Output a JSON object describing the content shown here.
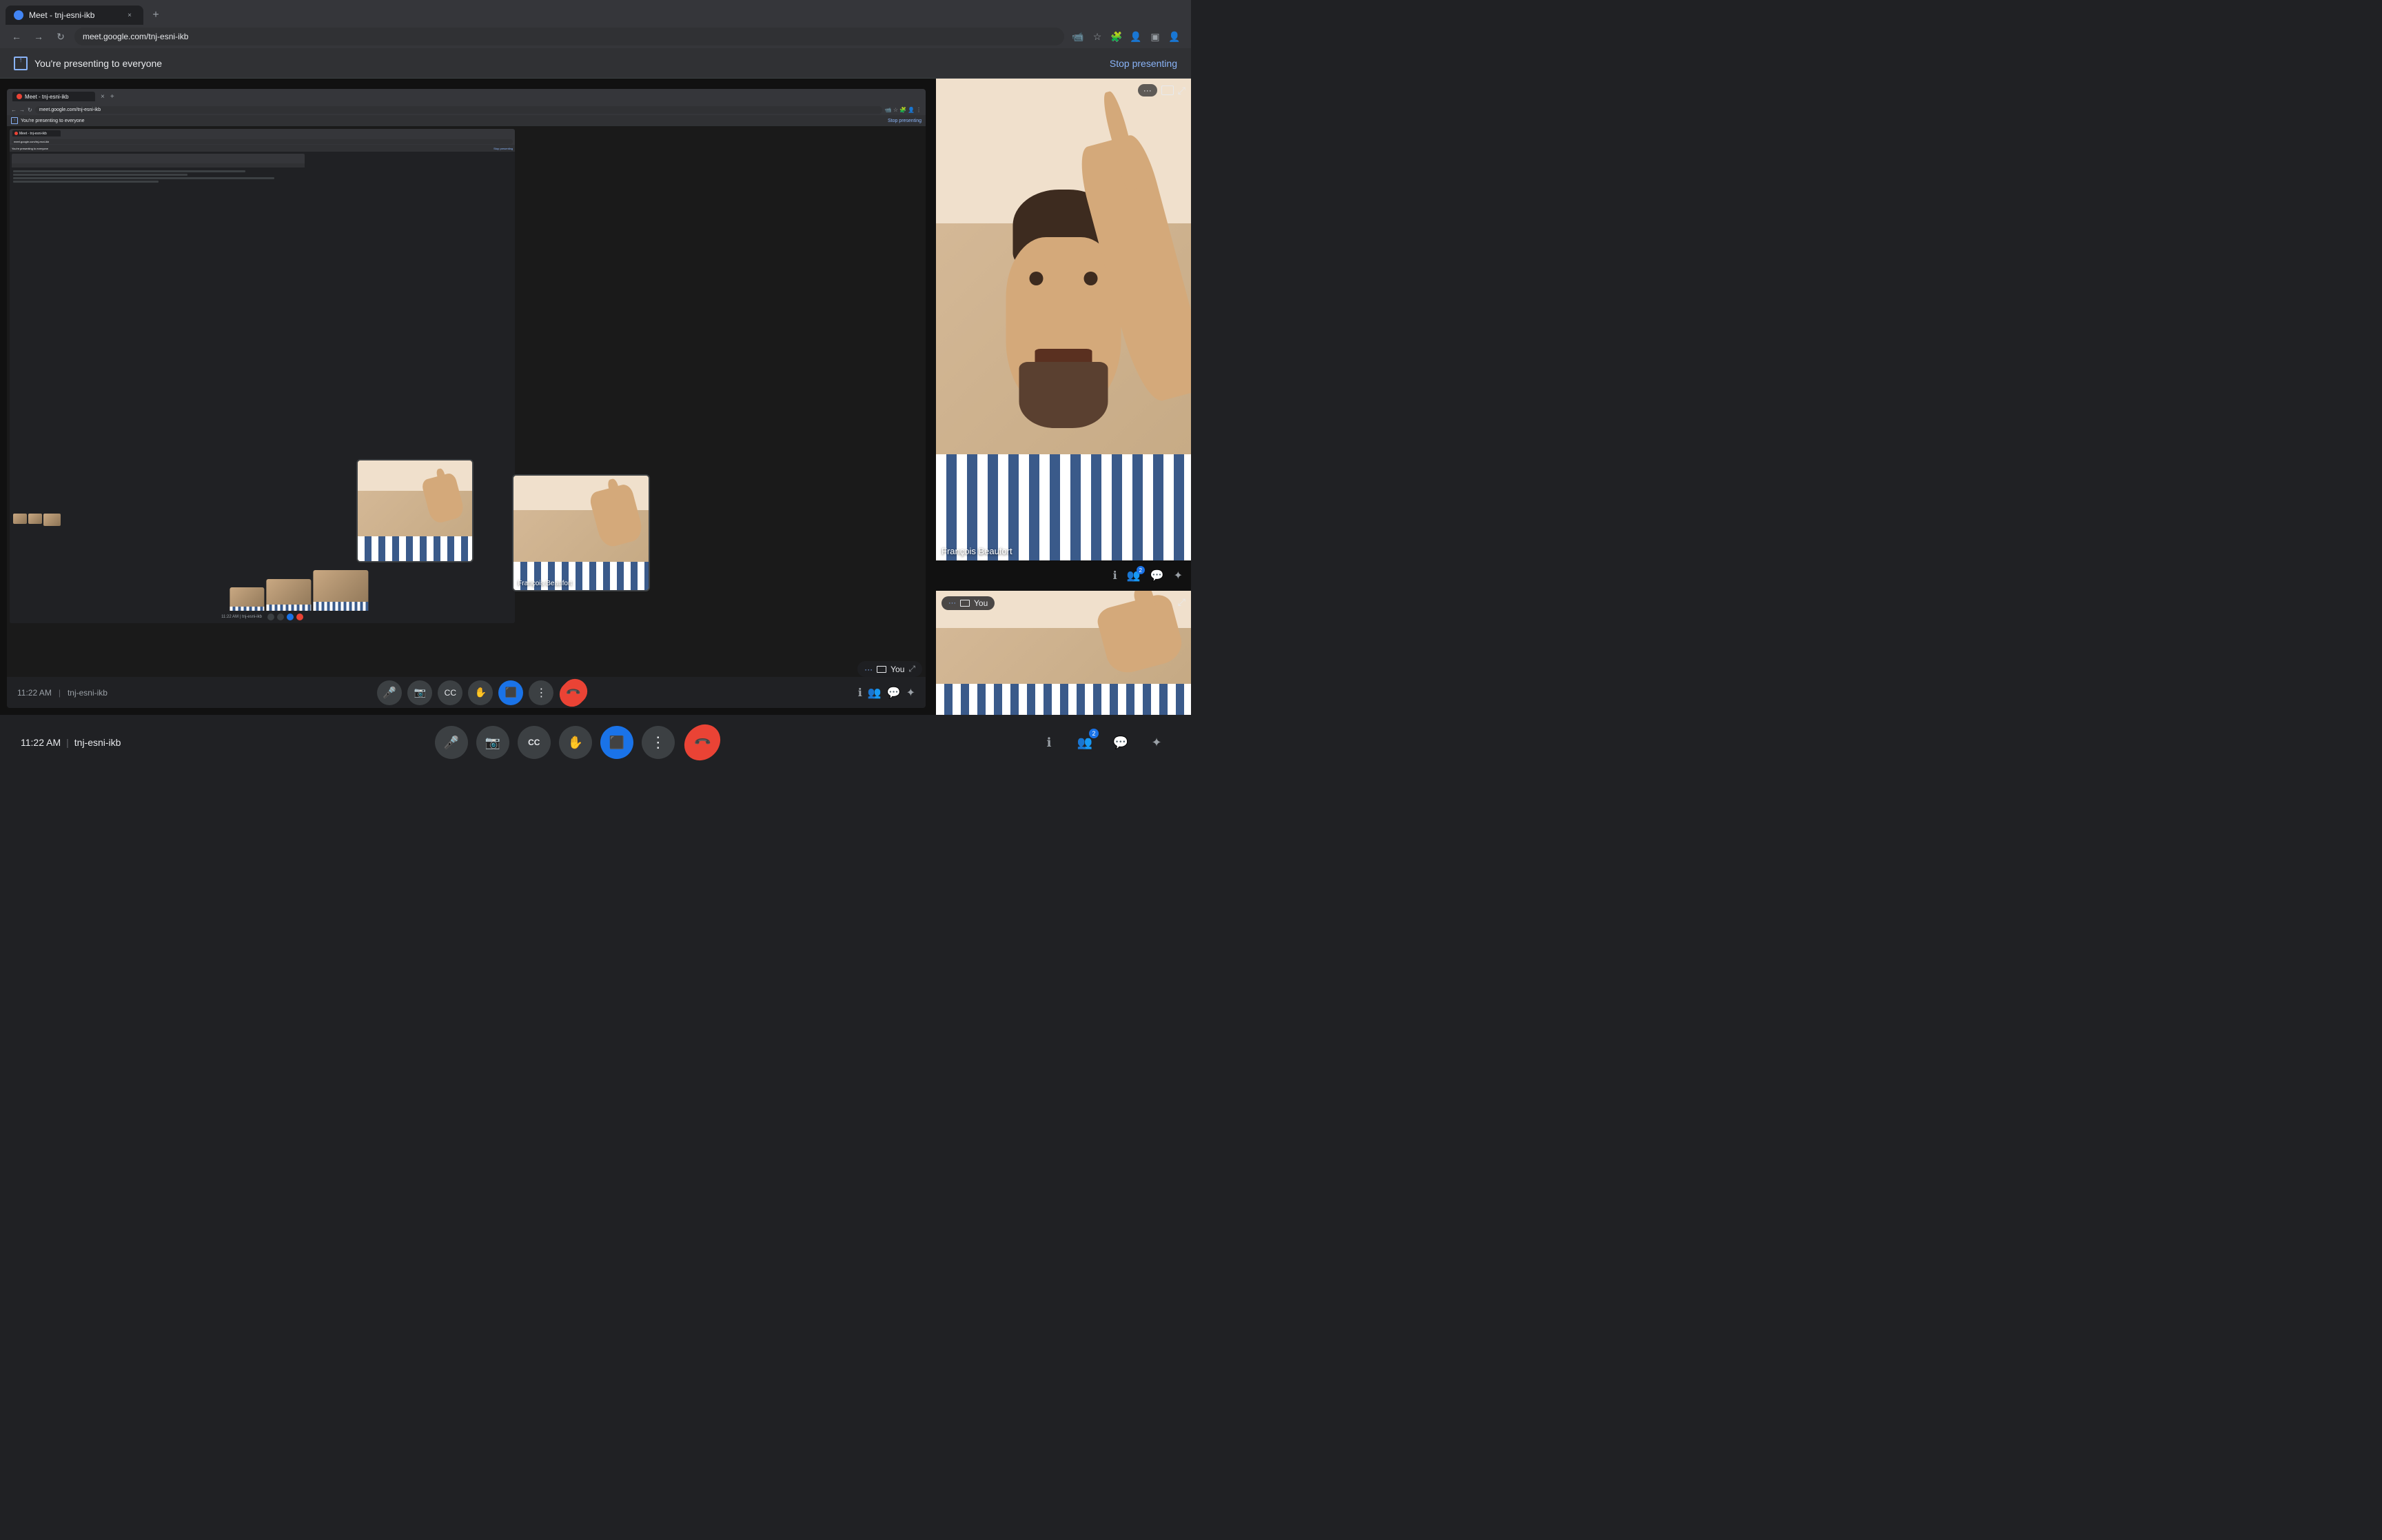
{
  "browser": {
    "tab_title": "Meet - tnj-esni-ikb",
    "tab_favicon": "meet-favicon",
    "url": "meet.google.com/tnj-esni-ikb",
    "new_tab_icon": "+",
    "close_icon": "×",
    "nav_back": "←",
    "nav_forward": "→",
    "nav_reload": "↻"
  },
  "notification_bar": {
    "message": "You're presenting to everyone",
    "stop_button_label": "Stop presenting"
  },
  "meeting": {
    "time": "11:22 AM",
    "meeting_id": "tnj-esni-ikb",
    "separator": "|",
    "participant_name": "François Beaufort",
    "you_label": "You"
  },
  "controls": {
    "mic_icon": "🎤",
    "camera_icon": "📷",
    "captions_icon": "CC",
    "raise_hand_icon": "✋",
    "present_icon": "⬛",
    "more_icon": "⋮",
    "end_call_icon": "📞",
    "info_icon": "ℹ",
    "people_icon": "👥",
    "chat_icon": "💬",
    "activities_icon": "☰"
  },
  "right_panel": {
    "info_icon": "ℹ",
    "people_icon": "👥",
    "chat_icon": "💬",
    "activities_icon": "✦",
    "people_count": "2"
  },
  "you_tile": {
    "label": "You",
    "expand_icon": "⤢",
    "menu_icon": "···"
  }
}
